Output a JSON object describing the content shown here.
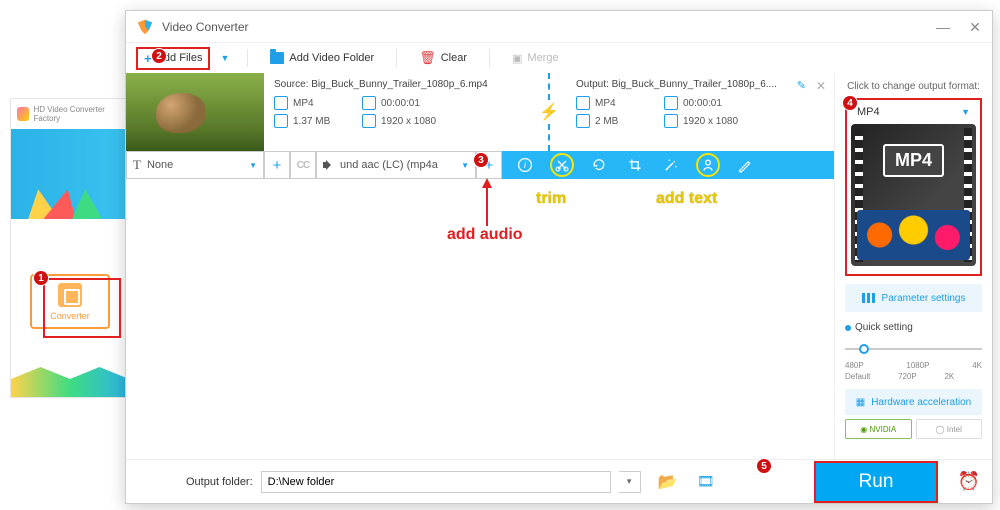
{
  "bg_app": {
    "title": "HD Video Converter Factory",
    "converter_label": "Converter"
  },
  "window": {
    "title": "Video Converter"
  },
  "toolbar": {
    "add_files": "Add Files",
    "add_folder": "Add Video Folder",
    "clear": "Clear",
    "merge": "Merge"
  },
  "file": {
    "source_label": "Source:",
    "source_name": "Big_Buck_Bunny_Trailer_1080p_6.mp4",
    "output_label": "Output:",
    "output_name": "Big_Buck_Bunny_Trailer_1080p_6....",
    "src": {
      "format": "MP4",
      "duration": "00:00:01",
      "size": "1.37 MB",
      "resolution": "1920 x 1080"
    },
    "out": {
      "format": "MP4",
      "duration": "00:00:01",
      "size": "2 MB",
      "resolution": "1920 x 1080"
    }
  },
  "strip": {
    "subtitle_value": "None",
    "audio_value": "und aac (LC) (mp4a"
  },
  "right": {
    "change_format": "Click to change output format:",
    "format": "MP4",
    "badge": "MP4",
    "param_settings": "Parameter settings",
    "quick_setting": "Quick setting",
    "slider_top": [
      "480P",
      "1080P",
      "4K"
    ],
    "slider_bottom": [
      "Default",
      "720P",
      "2K",
      ""
    ],
    "hw_accel": "Hardware acceleration",
    "nvidia": "NVIDIA",
    "intel": "Intel"
  },
  "bottom": {
    "output_folder_label": "Output folder:",
    "output_folder_value": "D:\\New folder",
    "run": "Run"
  },
  "annotations": {
    "add_audio": "add audio",
    "trim": "trim",
    "add_text": "add text"
  }
}
